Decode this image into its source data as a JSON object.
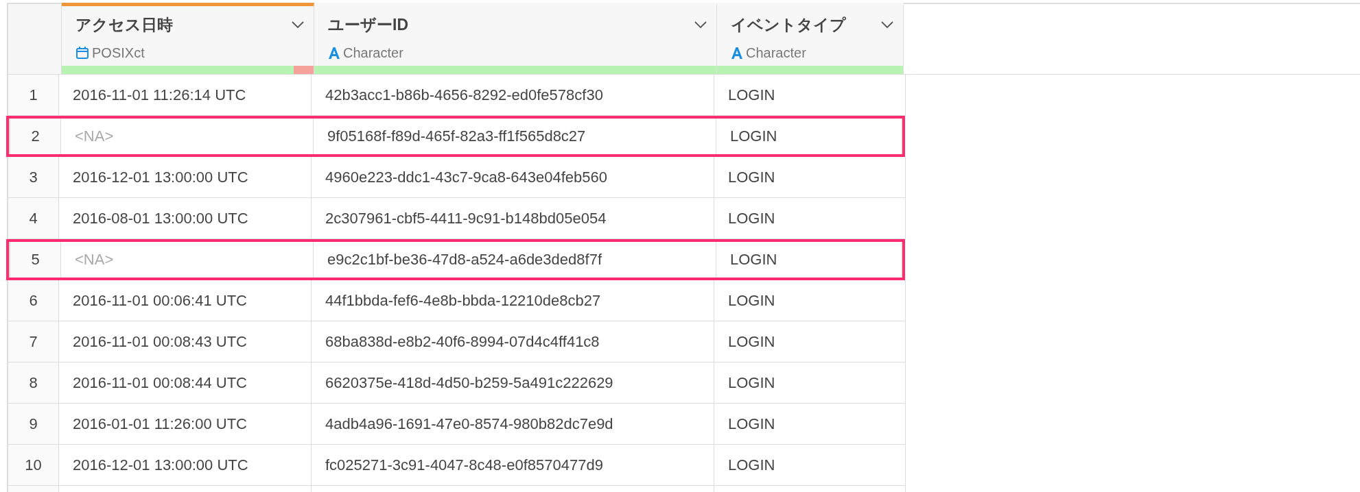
{
  "columns": [
    {
      "title": "アクセス日時",
      "type_label": "POSIXct",
      "kind": "date",
      "selected": true,
      "level": 0.92
    },
    {
      "title": "ユーザーID",
      "type_label": "Character",
      "kind": "character",
      "selected": false,
      "level": 1
    },
    {
      "title": "イベントタイプ",
      "type_label": "Character",
      "kind": "character",
      "selected": false,
      "level": 1
    }
  ],
  "rows": [
    {
      "index": "1",
      "highlighted": false,
      "cells": [
        {
          "text": "2016-11-01 11:26:14 UTC",
          "missing": false
        },
        {
          "text": "42b3acc1-b86b-4656-8292-ed0fe578cf30",
          "missing": false
        },
        {
          "text": "LOGIN",
          "missing": false
        }
      ]
    },
    {
      "index": "2",
      "highlighted": true,
      "cells": [
        {
          "text": "<NA>",
          "missing": true
        },
        {
          "text": "9f05168f-f89d-465f-82a3-ff1f565d8c27",
          "missing": false
        },
        {
          "text": "LOGIN",
          "missing": false
        }
      ]
    },
    {
      "index": "3",
      "highlighted": false,
      "cells": [
        {
          "text": "2016-12-01 13:00:00 UTC",
          "missing": false
        },
        {
          "text": "4960e223-ddc1-43c7-9ca8-643e04feb560",
          "missing": false
        },
        {
          "text": "LOGIN",
          "missing": false
        }
      ]
    },
    {
      "index": "4",
      "highlighted": false,
      "cells": [
        {
          "text": "2016-08-01 13:00:00 UTC",
          "missing": false
        },
        {
          "text": "2c307961-cbf5-4411-9c91-b148bd05e054",
          "missing": false
        },
        {
          "text": "LOGIN",
          "missing": false
        }
      ]
    },
    {
      "index": "5",
      "highlighted": true,
      "cells": [
        {
          "text": "<NA>",
          "missing": true
        },
        {
          "text": "e9c2c1bf-be36-47d8-a524-a6de3ded8f7f",
          "missing": false
        },
        {
          "text": "LOGIN",
          "missing": false
        }
      ]
    },
    {
      "index": "6",
      "highlighted": false,
      "cells": [
        {
          "text": "2016-11-01 00:06:41 UTC",
          "missing": false
        },
        {
          "text": "44f1bbda-fef6-4e8b-bbda-12210de8cb27",
          "missing": false
        },
        {
          "text": "LOGIN",
          "missing": false
        }
      ]
    },
    {
      "index": "7",
      "highlighted": false,
      "cells": [
        {
          "text": "2016-11-01 00:08:43 UTC",
          "missing": false
        },
        {
          "text": "68ba838d-e8b2-40f6-8994-07d4c4ff41c8",
          "missing": false
        },
        {
          "text": "LOGIN",
          "missing": false
        }
      ]
    },
    {
      "index": "8",
      "highlighted": false,
      "cells": [
        {
          "text": "2016-11-01 00:08:44 UTC",
          "missing": false
        },
        {
          "text": "6620375e-418d-4d50-b259-5a491c222629",
          "missing": false
        },
        {
          "text": "LOGIN",
          "missing": false
        }
      ]
    },
    {
      "index": "9",
      "highlighted": false,
      "cells": [
        {
          "text": "2016-01-01 11:26:00 UTC",
          "missing": false
        },
        {
          "text": "4adb4a96-1691-47e0-8574-980b82dc7e9d",
          "missing": false
        },
        {
          "text": "LOGIN",
          "missing": false
        }
      ]
    },
    {
      "index": "10",
      "highlighted": false,
      "cells": [
        {
          "text": "2016-12-01 13:00:00 UTC",
          "missing": false
        },
        {
          "text": "fc025271-3c91-4047-8c48-e0f8570477d9",
          "missing": false
        },
        {
          "text": "LOGIN",
          "missing": false
        }
      ]
    }
  ]
}
